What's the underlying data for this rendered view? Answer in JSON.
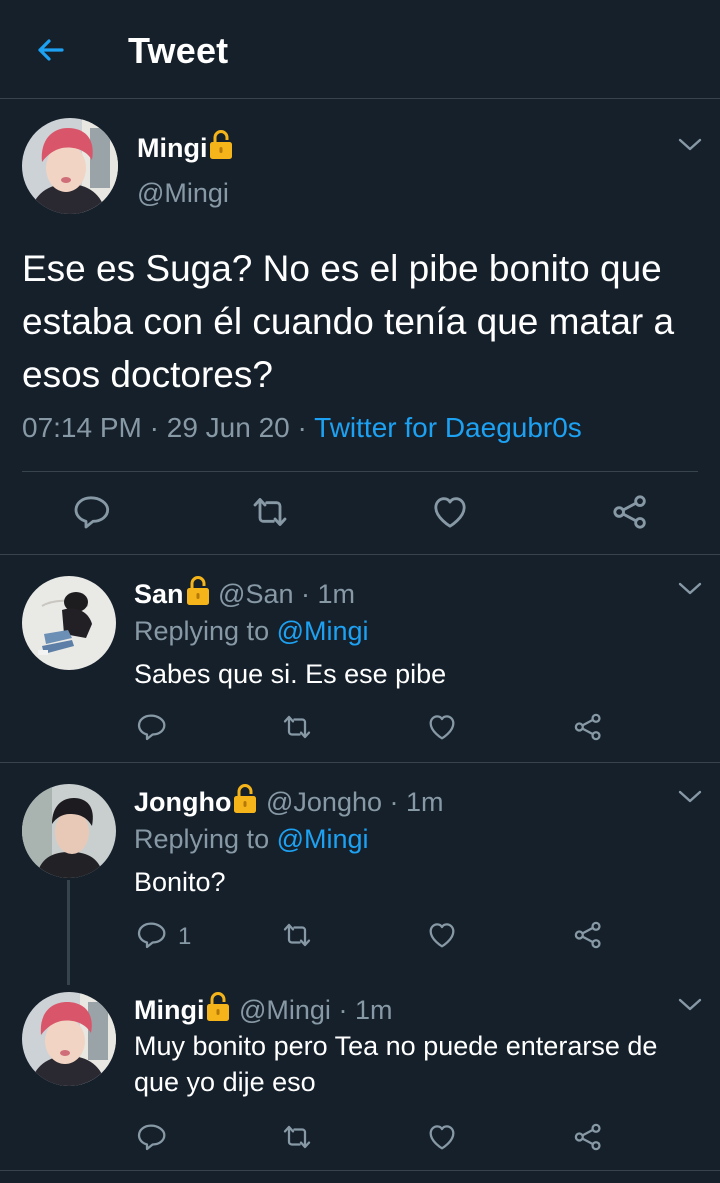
{
  "header": {
    "title": "Tweet",
    "back_icon": "arrow-left-icon",
    "accent": "#1da1f2"
  },
  "main_tweet": {
    "name": "Mingi",
    "handle": "@Mingi",
    "text": "Ese es Suga? No es el pibe bonito que estaba con él cuando tenía que matar a esos doctores?",
    "time": "07:14 PM",
    "date": "29 Jun 20",
    "source": "Twitter for Daegubr0s",
    "sep": "·"
  },
  "replies": [
    {
      "name": "San",
      "handle": "@San",
      "time": "1m",
      "replying_label": "Replying to",
      "replying_to": "@Mingi",
      "text": "Sabes que si. Es ese pibe",
      "reply_count": ""
    },
    {
      "name": "Jongho",
      "handle": "@Jongho",
      "time": "1m",
      "replying_label": "Replying to",
      "replying_to": "@Mingi",
      "text": "Bonito?",
      "reply_count": "1"
    },
    {
      "name": "Mingi",
      "handle": "@Mingi",
      "time": "1m",
      "text": "Muy bonito pero Tea no puede enterarse de que yo dije eso",
      "reply_count": ""
    }
  ],
  "icons": [
    "reply-icon",
    "retweet-icon",
    "like-icon",
    "share-icon",
    "lock-icon",
    "chevron-down-icon"
  ],
  "colors": {
    "background": "#15202b",
    "muted": "#8899a6",
    "border": "#38444d",
    "link": "#1da1f2",
    "lock": "#f5b51a"
  }
}
